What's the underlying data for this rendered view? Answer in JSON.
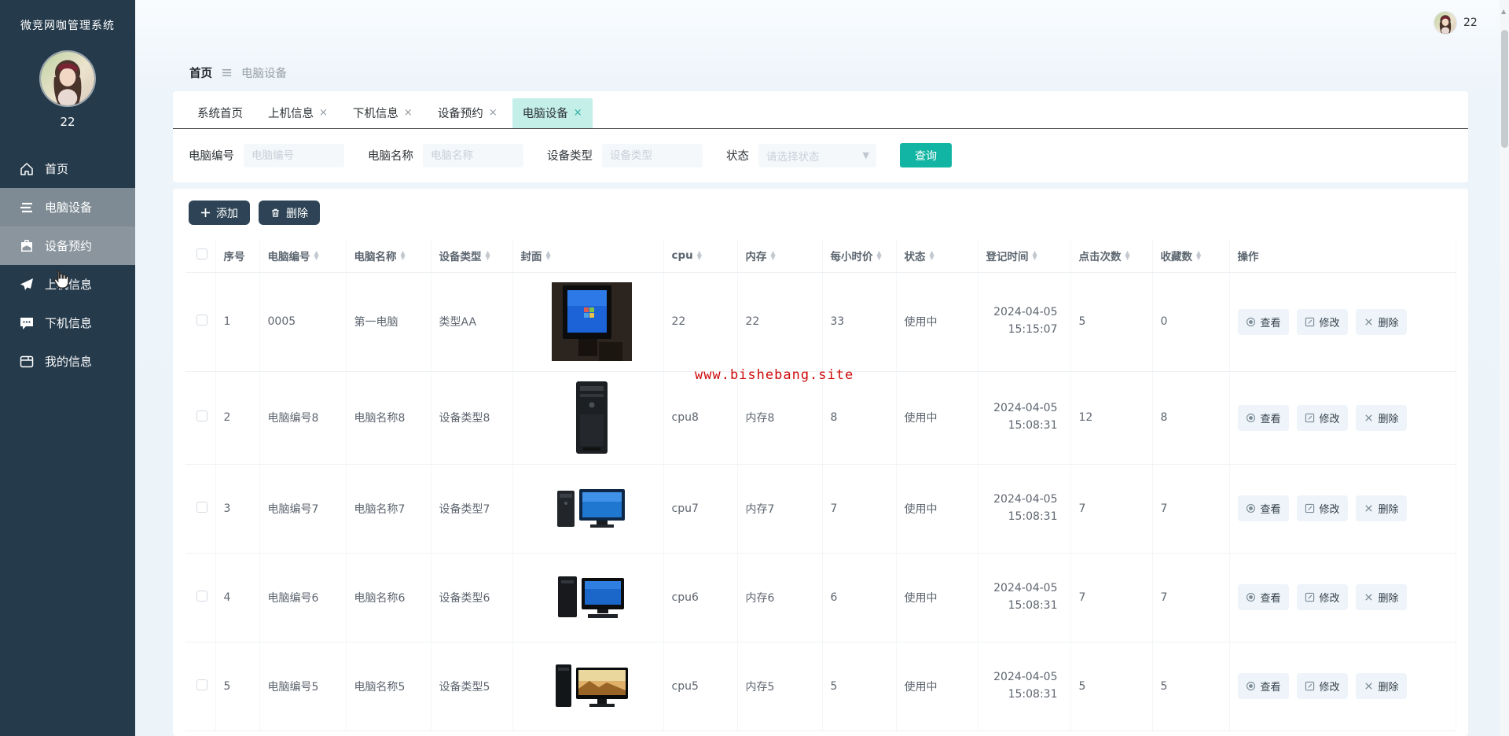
{
  "app": {
    "title": "微竞网咖管理系统",
    "username": "22"
  },
  "topbar": {
    "username": "22"
  },
  "breadcrumb": {
    "home": "首页",
    "current": "电脑设备"
  },
  "sidebar": {
    "items": [
      {
        "label": "首页",
        "icon": "home-icon",
        "state": "normal"
      },
      {
        "label": "电脑设备",
        "icon": "list-icon",
        "state": "active"
      },
      {
        "label": "设备预约",
        "icon": "briefcase-icon",
        "state": "hovered"
      },
      {
        "label": "上机信息",
        "icon": "send-icon",
        "state": "normal"
      },
      {
        "label": "下机信息",
        "icon": "chat-icon",
        "state": "normal"
      },
      {
        "label": "我的信息",
        "icon": "card-icon",
        "state": "normal"
      }
    ]
  },
  "tabs": [
    {
      "label": "系统首页",
      "closable": false,
      "active": false
    },
    {
      "label": "上机信息",
      "closable": true,
      "active": false
    },
    {
      "label": "下机信息",
      "closable": true,
      "active": false
    },
    {
      "label": "设备预约",
      "closable": true,
      "active": false
    },
    {
      "label": "电脑设备",
      "closable": true,
      "active": true
    }
  ],
  "filters": {
    "fields": [
      {
        "label": "电脑编号",
        "placeholder": "电脑编号"
      },
      {
        "label": "电脑名称",
        "placeholder": "电脑名称"
      },
      {
        "label": "设备类型",
        "placeholder": "设备类型"
      }
    ],
    "status": {
      "label": "状态",
      "placeholder": "请选择状态"
    },
    "search_label": "查询"
  },
  "toolbar": {
    "add_label": "添加",
    "delete_label": "删除"
  },
  "table": {
    "headers": [
      {
        "label": "",
        "kind": "checkbox",
        "sortable": false
      },
      {
        "label": "序号",
        "sortable": false
      },
      {
        "label": "电脑编号",
        "sortable": true
      },
      {
        "label": "电脑名称",
        "sortable": true
      },
      {
        "label": "设备类型",
        "sortable": true
      },
      {
        "label": "封面",
        "sortable": true
      },
      {
        "label": "cpu",
        "sortable": true
      },
      {
        "label": "内存",
        "sortable": true
      },
      {
        "label": "每小时价",
        "sortable": true
      },
      {
        "label": "状态",
        "sortable": true
      },
      {
        "label": "登记时间",
        "sortable": true
      },
      {
        "label": "点击次数",
        "sortable": true
      },
      {
        "label": "收藏数",
        "sortable": true
      },
      {
        "label": "操作",
        "sortable": false
      }
    ],
    "rows": [
      {
        "index": "1",
        "code": "0005",
        "name": "第一电脑",
        "type": "类型AA",
        "cover": "crt-blue",
        "cpu": "22",
        "memory": "22",
        "price": "33",
        "status": "使用中",
        "date": "2024-04-05",
        "time": "15:15:07",
        "clicks": "5",
        "favorites": "0"
      },
      {
        "index": "2",
        "code": "电脑编号8",
        "name": "电脑名称8",
        "type": "设备类型8",
        "cover": "tower-black",
        "cpu": "cpu8",
        "memory": "内存8",
        "price": "8",
        "status": "使用中",
        "date": "2024-04-05",
        "time": "15:08:31",
        "clicks": "12",
        "favorites": "8"
      },
      {
        "index": "3",
        "code": "电脑编号7",
        "name": "电脑名称7",
        "type": "设备类型7",
        "cover": "desktop-set",
        "cpu": "cpu7",
        "memory": "内存7",
        "price": "7",
        "status": "使用中",
        "date": "2024-04-05",
        "time": "15:08:31",
        "clicks": "7",
        "favorites": "7"
      },
      {
        "index": "4",
        "code": "电脑编号6",
        "name": "电脑名称6",
        "type": "设备类型6",
        "cover": "tower-monitor-dark",
        "cpu": "cpu6",
        "memory": "内存6",
        "price": "6",
        "status": "使用中",
        "date": "2024-04-05",
        "time": "15:08:31",
        "clicks": "7",
        "favorites": "7"
      },
      {
        "index": "5",
        "code": "电脑编号5",
        "name": "电脑名称5",
        "type": "设备类型5",
        "cover": "tower-widescreen",
        "cpu": "cpu5",
        "memory": "内存5",
        "price": "5",
        "status": "使用中",
        "date": "2024-04-05",
        "time": "15:08:31",
        "clicks": "5",
        "favorites": "5"
      }
    ]
  },
  "row_actions": {
    "view": "查看",
    "edit": "修改",
    "delete": "删除"
  },
  "watermark": "www.bishebang.site",
  "colors": {
    "sidebar": "#253a4b",
    "accent_teal": "#12b5a3",
    "active_tab": "#c4efe9",
    "dark_button": "#2e4456",
    "watermark_red": "#cf0a0a"
  }
}
